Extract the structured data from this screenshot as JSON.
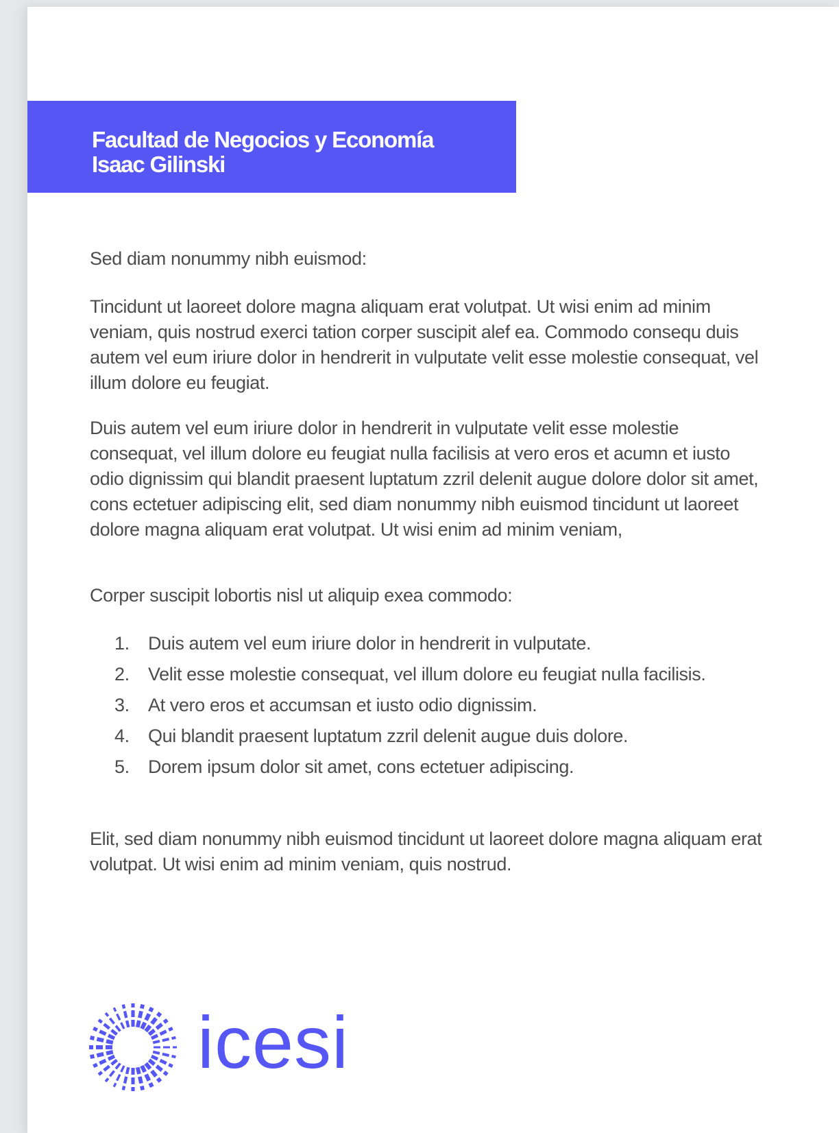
{
  "header": {
    "line1": "Facultad de Negocios y Economía",
    "line2": "Isaac Gilinski"
  },
  "content": {
    "p1": "Sed diam nonummy nibh euismod:",
    "p2": "Tincidunt ut laoreet dolore magna aliquam erat volutpat. Ut wisi enim ad minim veniam, quis nostrud exerci tation corper suscipit  alef ea. Commodo consequ duis autem vel eum iriure dolor in hendrerit in vulputate velit esse molestie consequat, vel illum dolore eu feugiat.",
    "p3": "Duis autem vel eum iriure dolor in hendrerit in vulputate velit esse molestie consequat, vel illum dolore eu feugiat nulla facilisis at vero eros et acumn et iusto odio dignissim qui blandit praesent luptatum zzril delenit augue dolore dolor sit amet, cons ectetuer adipiscing elit, sed diam nonummy nibh euismod tincidunt ut laoreet dolore magna aliquam erat volutpat. Ut wisi enim ad minim veniam,",
    "p4": "Corper suscipit lobortis nisl ut aliquip exea commodo:",
    "list": [
      {
        "num": "1.",
        "text": "Duis autem vel eum iriure dolor in hendrerit in vulputate."
      },
      {
        "num": "2.",
        "text": "Velit esse molestie consequat, vel illum dolore eu feugiat nulla facilisis."
      },
      {
        "num": "3.",
        "text": "At vero eros et accumsan et iusto odio dignissim."
      },
      {
        "num": "4.",
        "text": "Qui blandit praesent luptatum zzril delenit augue duis dolore."
      },
      {
        "num": "5.",
        "text": "Dorem ipsum dolor sit amet, cons ectetuer adipiscing."
      }
    ],
    "p5": "Elit, sed diam nonummy nibh euismod tincidunt ut laoreet dolore magna aliquam erat volutpat. Ut wisi enim ad minim veniam, quis nostrud."
  },
  "logo": {
    "wordmark": "icesi",
    "icon": "sunburst-icon",
    "color": "#5656f5"
  },
  "colors": {
    "accent": "#5656f5",
    "text": "#4c4c4c",
    "page": "#ffffff",
    "background": "#e6e7ea"
  }
}
